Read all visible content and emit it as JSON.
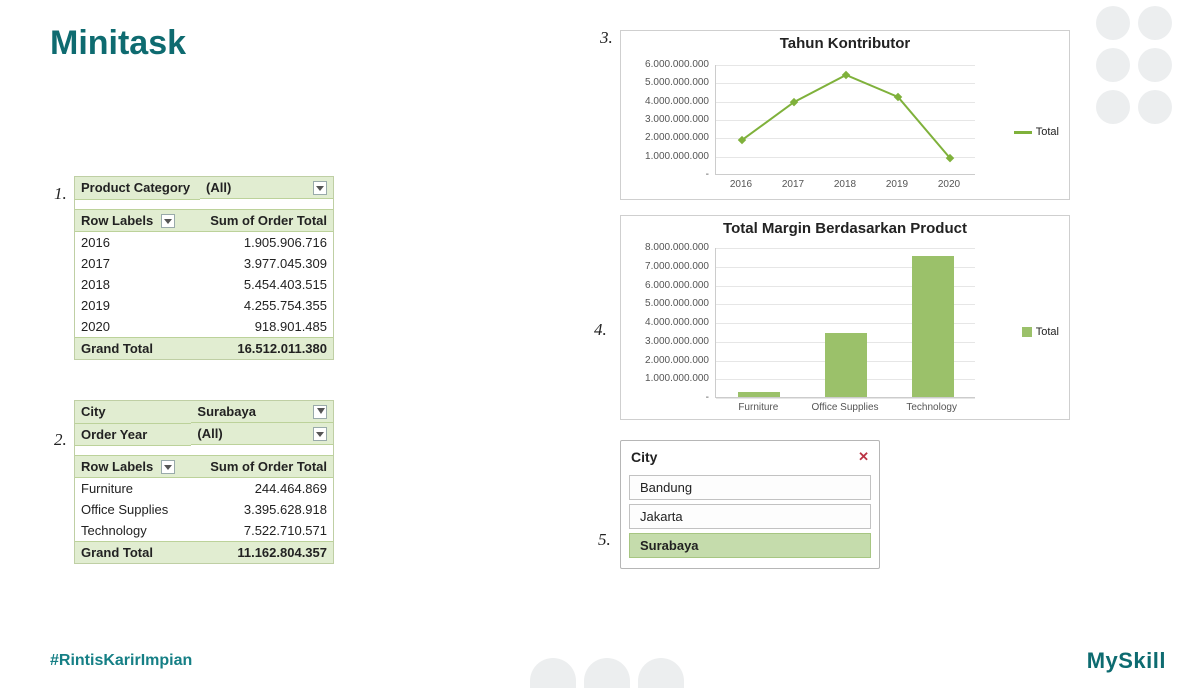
{
  "title": "Minitask",
  "hashtag": "#RintisKarirImpian",
  "brand": "MySkill",
  "labels": {
    "n1": "1.",
    "n2": "2.",
    "n3": "3.",
    "n4": "4.",
    "n5": "5."
  },
  "pivot1": {
    "filter_name": "Product Category",
    "filter_value": "(All)",
    "col_a": "Row Labels",
    "col_b": "Sum of Order Total",
    "rows": [
      {
        "label": "2016",
        "value": "1.905.906.716"
      },
      {
        "label": "2017",
        "value": "3.977.045.309"
      },
      {
        "label": "2018",
        "value": "5.454.403.515"
      },
      {
        "label": "2019",
        "value": "4.255.754.355"
      },
      {
        "label": "2020",
        "value": "918.901.485"
      }
    ],
    "grand_label": "Grand Total",
    "grand_value": "16.512.011.380"
  },
  "pivot2": {
    "filter1_name": "City",
    "filter1_value": "Surabaya",
    "filter2_name": "Order Year",
    "filter2_value": "(All)",
    "col_a": "Row Labels",
    "col_b": "Sum of Order Total",
    "rows": [
      {
        "label": "Furniture",
        "value": "244.464.869"
      },
      {
        "label": "Office Supplies",
        "value": "3.395.628.918"
      },
      {
        "label": "Technology",
        "value": "7.522.710.571"
      }
    ],
    "grand_label": "Grand Total",
    "grand_value": "11.162.804.357"
  },
  "slicer": {
    "title": "City",
    "items": [
      {
        "label": "Bandung",
        "selected": false
      },
      {
        "label": "Jakarta",
        "selected": false
      },
      {
        "label": "Surabaya",
        "selected": true
      }
    ]
  },
  "chart_data": [
    {
      "type": "line",
      "title": "Tahun Kontributor",
      "xlabel": "",
      "ylabel": "",
      "categories": [
        "2016",
        "2017",
        "2018",
        "2019",
        "2020"
      ],
      "series": [
        {
          "name": "Total",
          "values": [
            1905906716,
            3977045309,
            5454403515,
            4255754355,
            918901485
          ]
        }
      ],
      "ylim": [
        0,
        6000000000
      ],
      "yticks": [
        "-",
        "1.000.000.000",
        "2.000.000.000",
        "3.000.000.000",
        "4.000.000.000",
        "5.000.000.000",
        "6.000.000.000"
      ],
      "legend": "Total"
    },
    {
      "type": "bar",
      "title": "Total Margin Berdasarkan Product",
      "xlabel": "",
      "ylabel": "",
      "categories": [
        "Furniture",
        "Office Supplies",
        "Technology"
      ],
      "series": [
        {
          "name": "Total",
          "values": [
            244464869,
            3395628918,
            7522710571
          ]
        }
      ],
      "ylim": [
        0,
        8000000000
      ],
      "yticks": [
        "-",
        "1.000.000.000",
        "2.000.000.000",
        "3.000.000.000",
        "4.000.000.000",
        "5.000.000.000",
        "6.000.000.000",
        "7.000.000.000",
        "8.000.000.000"
      ],
      "legend": "Total"
    }
  ]
}
